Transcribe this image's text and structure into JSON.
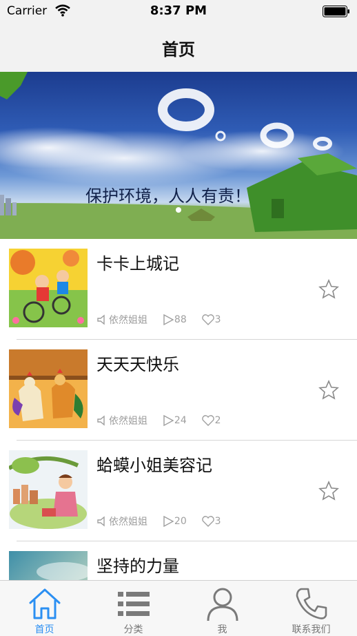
{
  "status_bar": {
    "carrier": "Carrier",
    "time": "8:37 PM"
  },
  "nav": {
    "title": "首页"
  },
  "banner": {
    "caption": "保护环境，人人有责！",
    "page_count": 2,
    "current_page": 1
  },
  "items": [
    {
      "title": "卡卡上城记",
      "author": "依然姐姐",
      "plays": "88",
      "likes": "3",
      "thumb_icon": "kids-cycling-illustration"
    },
    {
      "title": "天天天快乐",
      "author": "依然姐姐",
      "plays": "24",
      "likes": "2",
      "thumb_icon": "roosters-illustration"
    },
    {
      "title": "蛤蟆小姐美容记",
      "author": "依然姐姐",
      "plays": "20",
      "likes": "3",
      "thumb_icon": "girl-picnic-illustration"
    },
    {
      "title": "坚持的力量",
      "author": "",
      "plays": "",
      "likes": "",
      "thumb_icon": "sky-landscape-photo"
    }
  ],
  "tabs": [
    {
      "label": "首页",
      "icon": "home-icon",
      "active": true
    },
    {
      "label": "分类",
      "icon": "list-icon",
      "active": false
    },
    {
      "label": "我",
      "icon": "person-icon",
      "active": false
    },
    {
      "label": "联系我们",
      "icon": "phone-icon",
      "active": false
    }
  ],
  "colors": {
    "accent": "#2b8ff2",
    "meta_text": "#9e9e9e",
    "bar_background": "#f2f2f2"
  }
}
